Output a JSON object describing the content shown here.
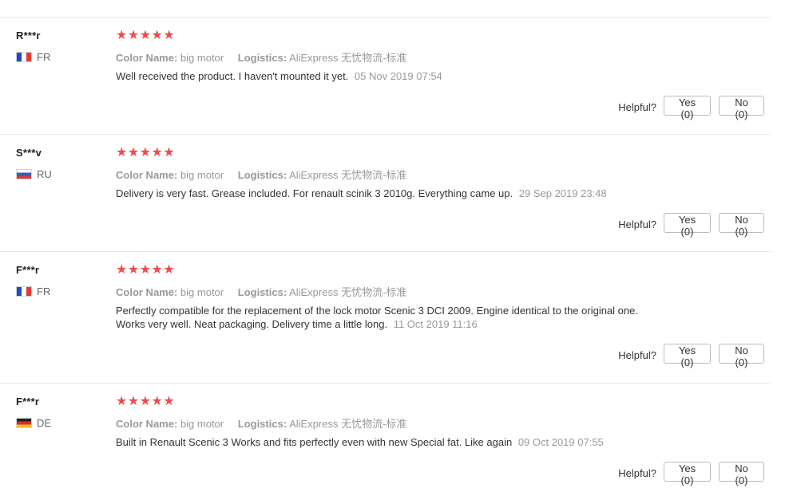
{
  "reviews": [
    {
      "user": "R***r",
      "country": "FR",
      "flag_icon": "flag-fr-icon",
      "stars": "★★★★★",
      "rating": 5,
      "color_label": "Color Name:",
      "color_value": "big motor",
      "logistics_label": "Logistics:",
      "logistics_value": "AliExpress 无忧物流-标准",
      "text": "Well received the product. I haven't mounted it yet.",
      "date": "05 Nov 2019 07:54",
      "helpful_label": "Helpful?",
      "yes_label": "Yes (0)",
      "no_label": "No (0)"
    },
    {
      "user": "S***v",
      "country": "RU",
      "flag_icon": "flag-ru-icon",
      "stars": "★★★★★",
      "rating": 5,
      "color_label": "Color Name:",
      "color_value": "big motor",
      "logistics_label": "Logistics:",
      "logistics_value": "AliExpress 无忧物流-标准",
      "text": "Delivery is very fast. Grease included. For renault scinik 3 2010g. Everything came up.",
      "date": "29 Sep 2019 23:48",
      "helpful_label": "Helpful?",
      "yes_label": "Yes (0)",
      "no_label": "No (0)"
    },
    {
      "user": "F***r",
      "country": "FR",
      "flag_icon": "flag-fr-icon",
      "stars": "★★★★★",
      "rating": 5,
      "color_label": "Color Name:",
      "color_value": "big motor",
      "logistics_label": "Logistics:",
      "logistics_value": "AliExpress 无忧物流-标准",
      "text_line1": "Perfectly compatible for the replacement of the lock motor Scenic 3 DCI 2009. Engine identical to the original one.",
      "text_line2": "Works very well. Neat packaging. Delivery time a little long.",
      "date": "11 Oct 2019 11:16",
      "helpful_label": "Helpful?",
      "yes_label": "Yes (0)",
      "no_label": "No (0)"
    },
    {
      "user": "F***r",
      "country": "DE",
      "flag_icon": "flag-de-icon",
      "stars": "★★★★★",
      "rating": 5,
      "color_label": "Color Name:",
      "color_value": "big motor",
      "logistics_label": "Logistics:",
      "logistics_value": "AliExpress 无忧物流-标准",
      "text": "Built in Renault Scenic 3 Works and fits perfectly even with new Special fat. Like again",
      "date": "09 Oct 2019 07:55",
      "helpful_label": "Helpful?",
      "yes_label": "Yes (0)",
      "no_label": "No (0)"
    }
  ],
  "colors": {
    "star": "#ef4b4b",
    "muted": "#999999",
    "text": "#333333",
    "divider": "#e8e8e8"
  }
}
